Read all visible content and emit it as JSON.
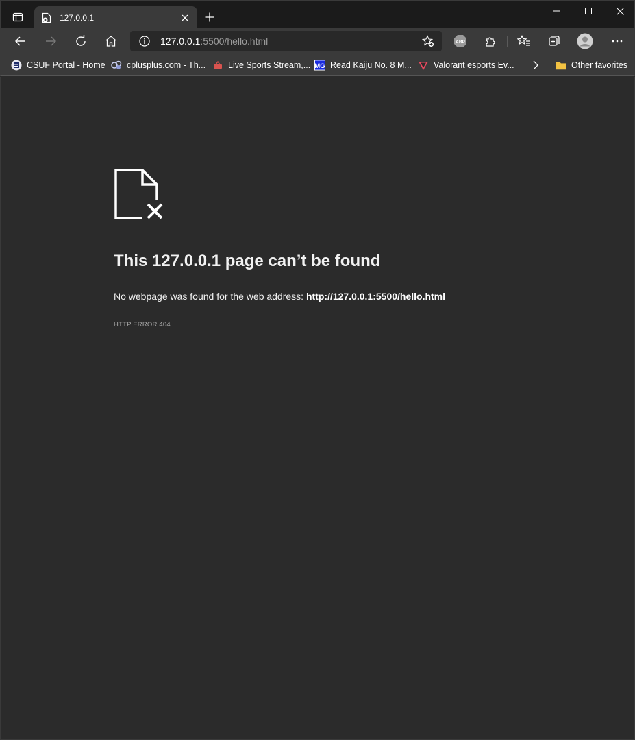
{
  "tab": {
    "title": "127.0.0.1",
    "favicon": "page-error-icon"
  },
  "window_controls": [
    "minimize-icon",
    "maximize-icon",
    "close-icon"
  ],
  "toolbar": {
    "buttons": [
      "back-icon",
      "forward-icon",
      "refresh-icon",
      "home-icon"
    ],
    "right_buttons": [
      "adblock-icon",
      "extensions-icon",
      "favorites-icon",
      "collections-icon",
      "profile-icon",
      "more-icon"
    ]
  },
  "address_bar": {
    "host": "127.0.0.1",
    "path": ":5500/hello.html"
  },
  "favorites_bar": {
    "items": [
      {
        "label": "CSUF Portal - Home",
        "icon": "csuf-icon"
      },
      {
        "label": "cplusplus.com - Th...",
        "icon": "cplusplus-icon"
      },
      {
        "label": "Live Sports Stream,...",
        "icon": "sports-icon"
      },
      {
        "label": "Read Kaiju No. 8 M...",
        "icon": "manga-icon"
      },
      {
        "label": "Valorant esports Ev...",
        "icon": "valorant-icon"
      }
    ],
    "other_favorites": "Other favorites"
  },
  "error_page": {
    "title": "This 127.0.0.1 page can’t be found",
    "description_prefix": "No webpage was found for the web address: ",
    "url": "http://127.0.0.1:5500/hello.html",
    "error_code": "HTTP ERROR 404"
  },
  "colors": {
    "page_bg": "#2b2b2b",
    "toolbar_bg": "#3a3a3a",
    "titlebar_bg": "#1b1b1b",
    "omnibox_bg": "#282828"
  }
}
